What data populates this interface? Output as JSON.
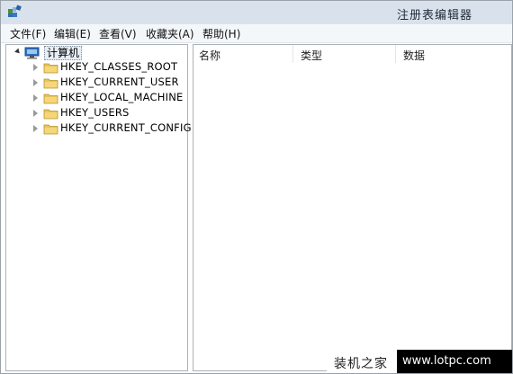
{
  "window": {
    "title": "注册表编辑器"
  },
  "menu": {
    "file": "文件(F)",
    "edit": "编辑(E)",
    "view": "查看(V)",
    "favorites": "收藏夹(A)",
    "help": "帮助(H)"
  },
  "tree": {
    "root": "计算机",
    "items": [
      {
        "label": "HKEY_CLASSES_ROOT"
      },
      {
        "label": "HKEY_CURRENT_USER"
      },
      {
        "label": "HKEY_LOCAL_MACHINE"
      },
      {
        "label": "HKEY_USERS"
      },
      {
        "label": "HKEY_CURRENT_CONFIG"
      }
    ]
  },
  "list": {
    "columns": [
      "名称",
      "类型",
      "数据"
    ]
  },
  "watermark": {
    "site_name": "装机之家",
    "url": "www.lotpc.com"
  },
  "icons": {
    "app": "registry-editor-icon",
    "computer": "computer-icon",
    "folder": "folder-icon"
  },
  "colors": {
    "titlebar": "#d9e2ec",
    "folder": "#e8c45a",
    "selection": "#e7eef6"
  }
}
